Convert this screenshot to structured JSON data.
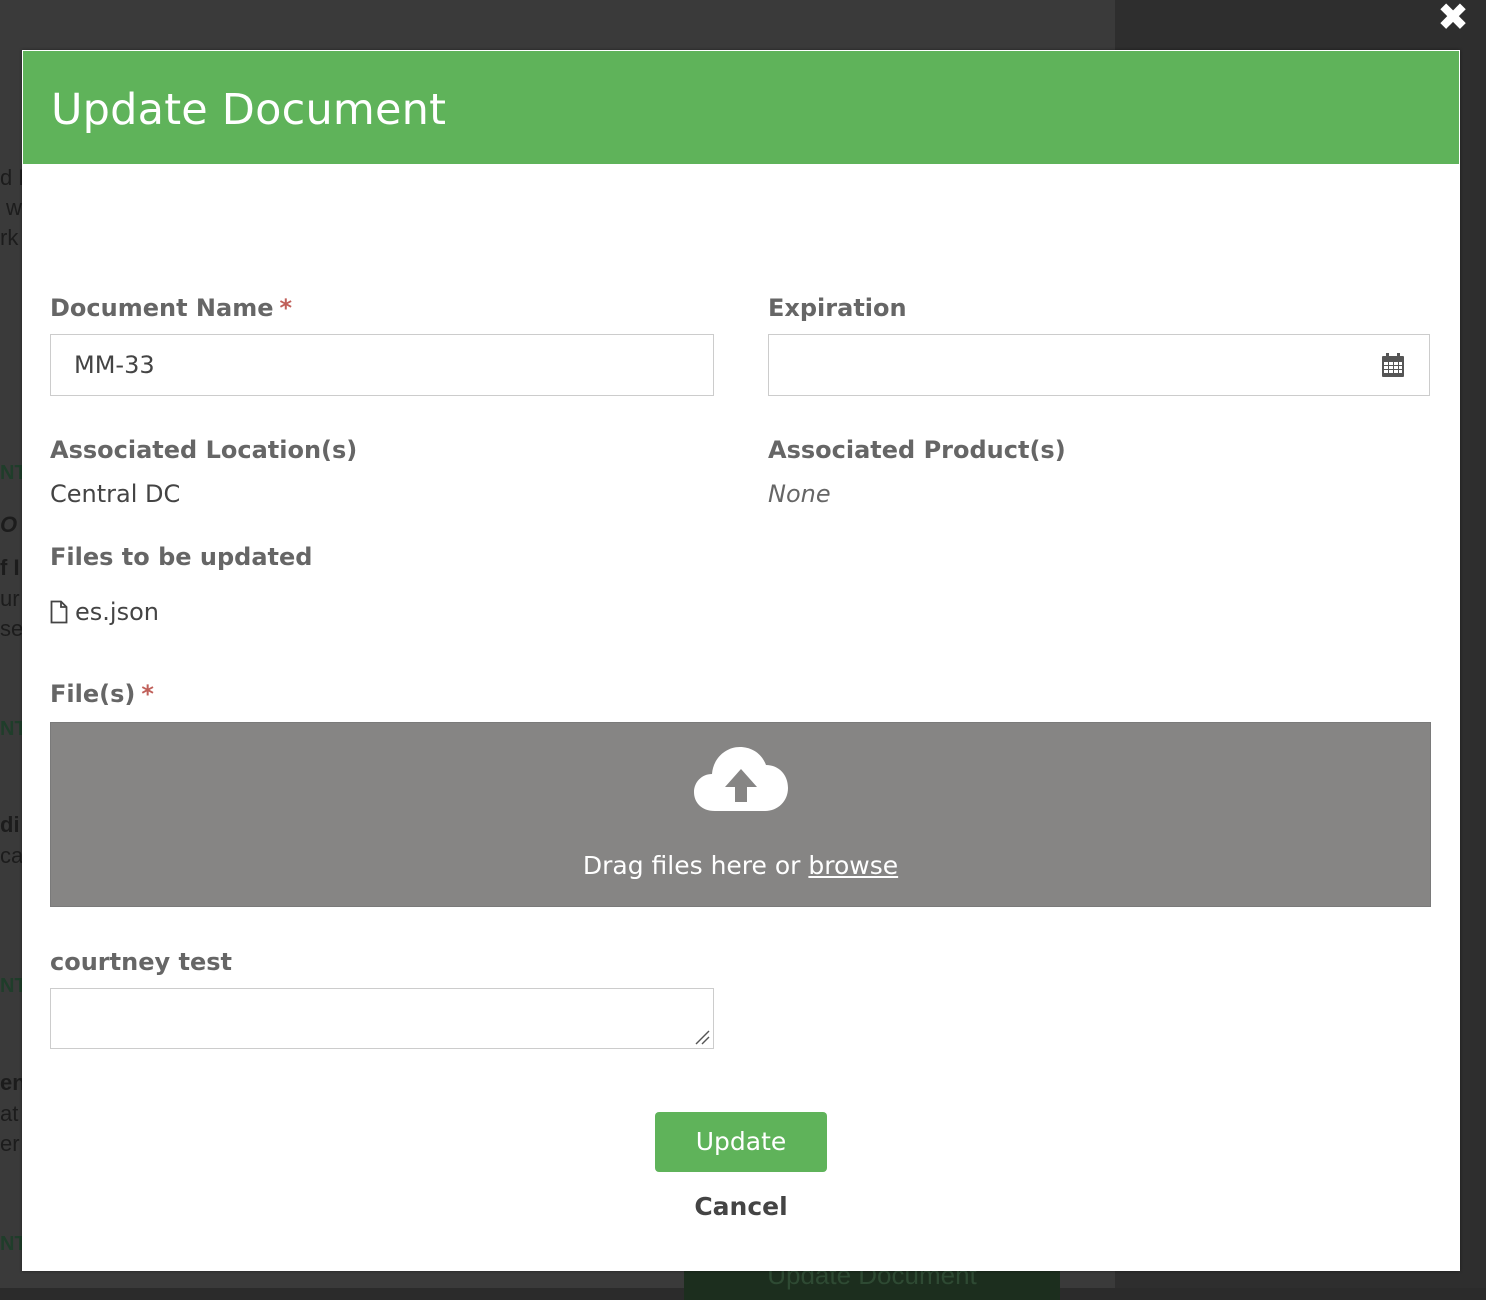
{
  "modal": {
    "title": "Update Document",
    "close_label": "✖"
  },
  "form": {
    "document_name": {
      "label": "Document Name",
      "required_mark": "*",
      "value": "MM-33"
    },
    "expiration": {
      "label": "Expiration",
      "value": ""
    },
    "locations": {
      "label": "Associated Location(s)",
      "value": "Central DC"
    },
    "products": {
      "label": "Associated Product(s)",
      "value": "None"
    },
    "files_to_update": {
      "label": "Files to be updated",
      "items": [
        "es.json"
      ]
    },
    "files": {
      "label": "File(s)",
      "required_mark": "*",
      "drop_text": "Drag files here or",
      "browse_label": "browse"
    },
    "courtney_test": {
      "label": "courtney test",
      "value": ""
    }
  },
  "actions": {
    "update_label": "Update",
    "cancel_label": "Cancel"
  },
  "colors": {
    "accent": "#5fb35a",
    "required": "#c0605a",
    "dropzone": "#868584"
  },
  "background": {
    "fragments": [
      "d F",
      "w",
      "rk",
      "NT",
      "O",
      "f I",
      "ur",
      "se",
      "NT",
      "di",
      "ca",
      "NT",
      "en",
      "at",
      "er",
      "NT"
    ],
    "bottom_button_label": "Update Document"
  }
}
